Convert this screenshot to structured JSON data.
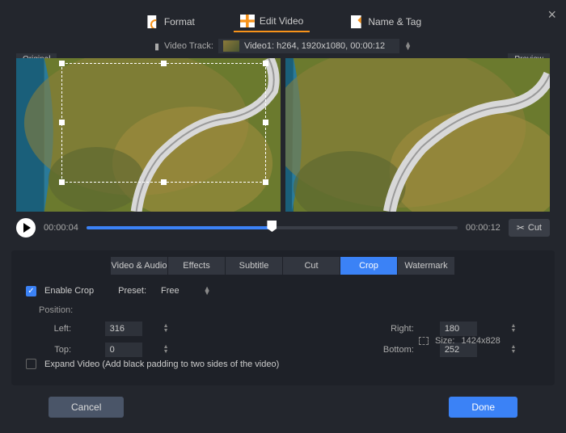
{
  "topTabs": {
    "format": "Format",
    "edit": "Edit Video",
    "name": "Name & Tag"
  },
  "videoTrack": {
    "label": "Video Track:",
    "value": "Video1: h264, 1920x1080, 00:00:12"
  },
  "previewLabels": {
    "original": "Original",
    "preview": "Preview"
  },
  "player": {
    "currentTime": "00:00:04",
    "duration": "00:00:12",
    "cut": "Cut"
  },
  "subTabs": [
    "Video & Audio",
    "Effects",
    "Subtitle",
    "Cut",
    "Crop",
    "Watermark"
  ],
  "crop": {
    "enable": "Enable Crop",
    "presetLabel": "Preset:",
    "presetValue": "Free",
    "positionLabel": "Position:",
    "left": {
      "label": "Left:",
      "value": "316"
    },
    "right": {
      "label": "Right:",
      "value": "180"
    },
    "top": {
      "label": "Top:",
      "value": "0"
    },
    "bottom": {
      "label": "Bottom:",
      "value": "252"
    },
    "sizeLabel": "Size:",
    "sizeValue": "1424x828",
    "expand": "Expand Video (Add black padding to two sides of the video)"
  },
  "footer": {
    "cancel": "Cancel",
    "done": "Done"
  }
}
